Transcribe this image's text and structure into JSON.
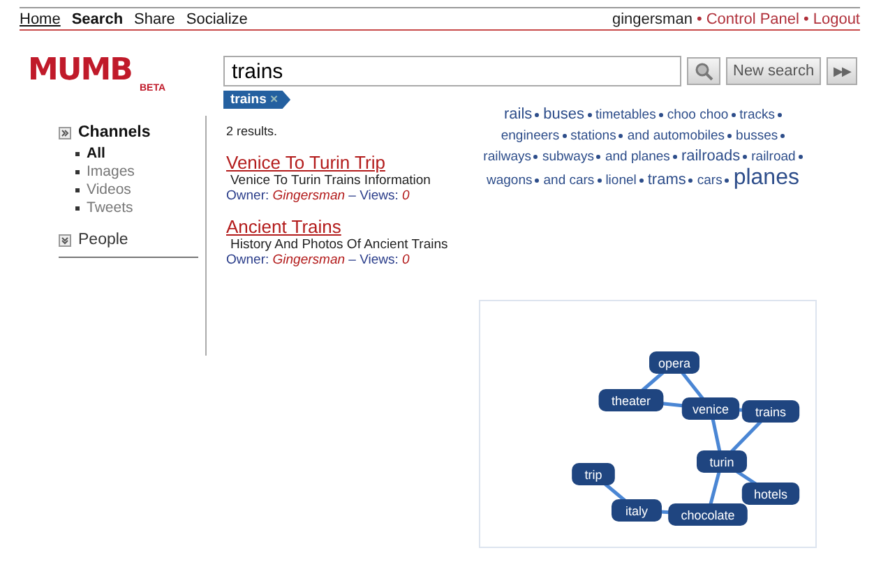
{
  "nav": {
    "links": [
      {
        "label": "Home",
        "selected": false
      },
      {
        "label": "Search",
        "selected": true
      },
      {
        "label": "Share",
        "selected": false
      },
      {
        "label": "Socialize",
        "selected": false
      }
    ],
    "user": "gingersman",
    "separator": "•",
    "account_links": [
      "Control Panel",
      "Logout"
    ]
  },
  "logo": {
    "text": "MUMB",
    "badge": "BETA"
  },
  "search": {
    "value": "trains",
    "button": "New search",
    "next": "▶▶",
    "chips": [
      {
        "label": "trains",
        "close": "×"
      }
    ]
  },
  "sidebar": {
    "sections": [
      {
        "label": "Channels",
        "expanded": true,
        "items": [
          {
            "label": "All",
            "selected": true
          },
          {
            "label": "Images",
            "selected": false
          },
          {
            "label": "Videos",
            "selected": false
          },
          {
            "label": "Tweets",
            "selected": false
          }
        ]
      },
      {
        "label": "People",
        "expanded": false
      }
    ]
  },
  "results": {
    "count": "2 results.",
    "meta_separator": "–",
    "items": [
      {
        "title": "Venice To Turin Trip",
        "description": "Venice To Turin Trains Information",
        "owner_label": "Owner:",
        "owner": "Gingersman",
        "views_label": "Views:",
        "views": "0"
      },
      {
        "title": "Ancient Trains",
        "description": "History And Photos Of Ancient Trains",
        "owner_label": "Owner:",
        "owner": "Gingersman",
        "views_label": "Views:",
        "views": "0"
      }
    ]
  },
  "tag_cloud": [
    {
      "label": "rails",
      "kind": "medium"
    },
    {
      "label": "buses",
      "kind": "medium"
    },
    {
      "label": "timetables",
      "kind": "small"
    },
    {
      "label": "choo choo",
      "kind": "small"
    },
    {
      "label": "tracks",
      "kind": "small"
    },
    {
      "label": "engineers",
      "kind": "small"
    },
    {
      "label": "stations",
      "kind": "small"
    },
    {
      "label": "and automobiles",
      "kind": "small"
    },
    {
      "label": "busses",
      "kind": "small"
    },
    {
      "label": "railways",
      "kind": "small"
    },
    {
      "label": "subways",
      "kind": "small"
    },
    {
      "label": "and planes",
      "kind": "small"
    },
    {
      "label": "railroads",
      "kind": "medium"
    },
    {
      "label": "railroad",
      "kind": "small"
    },
    {
      "label": "wagons",
      "kind": "small"
    },
    {
      "label": "and cars",
      "kind": "small"
    },
    {
      "label": "lionel",
      "kind": "small"
    },
    {
      "label": "trams",
      "kind": "medium"
    },
    {
      "label": "cars",
      "kind": "small"
    },
    {
      "label": "planes",
      "kind": "large"
    }
  ],
  "graph": {
    "nodes": [
      "opera",
      "theater",
      "venice",
      "trains",
      "turin",
      "hotels",
      "trip",
      "italy",
      "chocolate"
    ]
  }
}
